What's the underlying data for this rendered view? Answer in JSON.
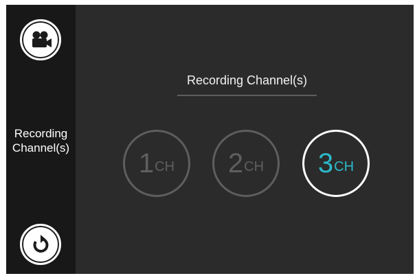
{
  "sidebar": {
    "top_icon": "video-camera-icon",
    "label": "Recording Channel(s)",
    "bottom_icon": "rotate-reset-icon"
  },
  "main": {
    "title": "Recording Channel(s)",
    "options": [
      {
        "number": "1",
        "unit": "CH",
        "selected": false
      },
      {
        "number": "2",
        "unit": "CH",
        "selected": false
      },
      {
        "number": "3",
        "unit": "CH",
        "selected": true
      }
    ]
  },
  "colors": {
    "background": "#2b2b2b",
    "sidebar": "#181818",
    "accent": "#2bb9c9",
    "inactive": "#5e5e5e"
  }
}
